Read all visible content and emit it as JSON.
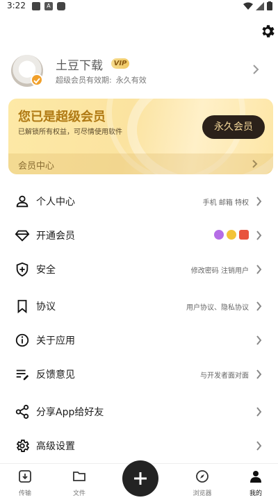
{
  "status_bar": {
    "time": "3:22",
    "mid_icon_letter": "A"
  },
  "header": {
    "settings_icon": "gear-icon"
  },
  "profile": {
    "username": "土豆下载",
    "vip_badge": "VIP",
    "membership_label": "超级会员有效期:",
    "membership_value": "永久有效"
  },
  "vip_card": {
    "title": "您已是超级会员",
    "subtitle": "已解锁所有权益，可尽情使用软件",
    "button_label": "永久会员",
    "footer_label": "会员中心"
  },
  "menu": [
    {
      "label": "个人中心",
      "right_text": "手机 邮箱 特权",
      "icon": "person-icon"
    },
    {
      "label": "开通会员",
      "right_text": "",
      "icon": "diamond-icon"
    },
    {
      "label": "安全",
      "right_text": "修改密码  注销用户",
      "icon": "shield-icon"
    },
    {
      "label": "协议",
      "right_text": "用户协议、隐私协议",
      "icon": "bookmark-icon"
    },
    {
      "label": "关于应用",
      "right_text": "",
      "icon": "info-icon"
    },
    {
      "label": "反馈意见",
      "right_text": "与开发者面对面",
      "icon": "feedback-icon"
    },
    {
      "label": "分享App给好友",
      "right_text": "",
      "icon": "share-icon"
    },
    {
      "label": "高级设置",
      "right_text": "",
      "icon": "settings-icon"
    }
  ],
  "member_icons": [
    "vip-purple-icon",
    "diamond-gold-icon",
    "gift-icon"
  ],
  "bottom_nav": [
    {
      "label": "传输",
      "icon": "transfer-icon"
    },
    {
      "label": "文件",
      "icon": "folder-icon"
    },
    {
      "label": "浏览器",
      "icon": "compass-icon"
    },
    {
      "label": "我的",
      "icon": "profile-icon",
      "active": true
    }
  ],
  "colors": {
    "accent_gold": "#b07a14",
    "vip_button_bg": "#2b211a",
    "fab_bg": "#232323"
  }
}
